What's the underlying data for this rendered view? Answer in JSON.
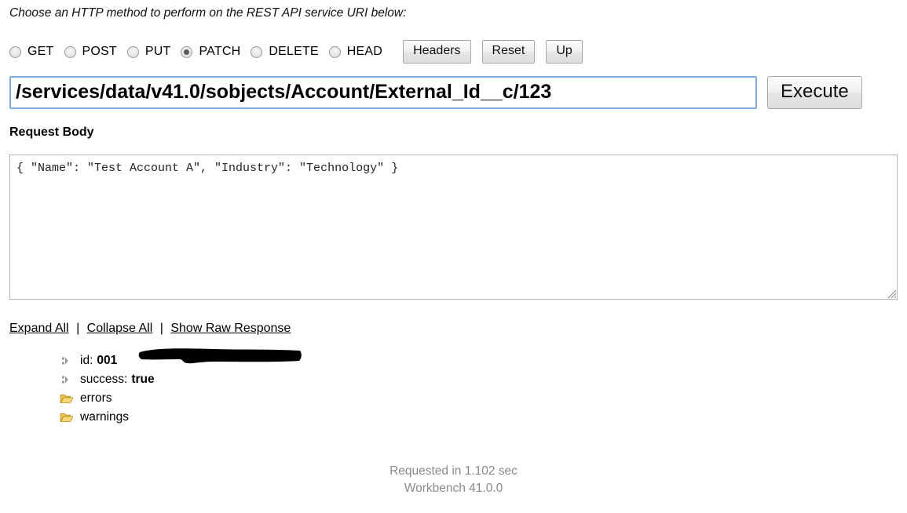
{
  "page": {
    "instruction": "Choose an HTTP method to perform on the REST API service URI below:"
  },
  "methods": {
    "options": [
      {
        "label": "GET",
        "checked": false
      },
      {
        "label": "POST",
        "checked": false
      },
      {
        "label": "PUT",
        "checked": false
      },
      {
        "label": "PATCH",
        "checked": true
      },
      {
        "label": "DELETE",
        "checked": false
      },
      {
        "label": "HEAD",
        "checked": false
      }
    ],
    "buttons": {
      "headers": "Headers",
      "reset": "Reset",
      "up": "Up"
    }
  },
  "uri": {
    "value": "/services/data/v41.0/sobjects/Account/External_Id__c/123",
    "placeholder": "/services/data/v41.0/",
    "execute_label": "Execute",
    "focus_border_color": "#7bacde"
  },
  "request_body": {
    "label": "Request Body",
    "value": "{ \"Name\": \"Test Account A\", \"Industry\": \"Technology\" }"
  },
  "response_controls": {
    "expand_all": "Expand All",
    "collapse_all": "Collapse All",
    "show_raw": "Show Raw Response",
    "separator": "|"
  },
  "response_tree": [
    {
      "icon": "leaf-node-icon",
      "key": "id:",
      "value": "001",
      "redacted": true
    },
    {
      "icon": "leaf-node-icon",
      "key": "success:",
      "value": "true",
      "redacted": false
    },
    {
      "icon": "folder-icon",
      "key": "errors",
      "value": "",
      "redacted": false
    },
    {
      "icon": "folder-icon",
      "key": "warnings",
      "value": "",
      "redacted": false
    }
  ],
  "footer": {
    "requested_in": "Requested in 1.102 sec",
    "version": "Workbench 41.0.0",
    "color": "#8a8a8a"
  }
}
